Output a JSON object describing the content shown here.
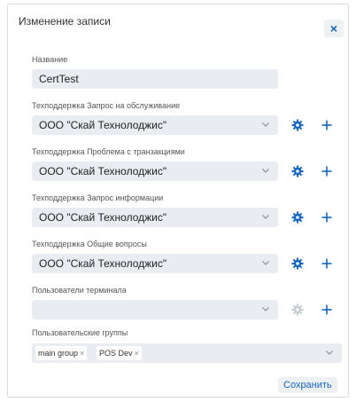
{
  "dialog": {
    "title": "Изменение записи",
    "close_label": "×",
    "save_label": "Сохранить"
  },
  "name_field": {
    "label": "Название",
    "value": "CertTest"
  },
  "selects": [
    {
      "label": "Техподдержка Запрос на обслуживание",
      "value": "ООО \"Скай Технолоджис\"",
      "gear_enabled": true
    },
    {
      "label": "Техподдержка Проблема с транзакциями",
      "value": "ООО \"Скай Технолоджис\"",
      "gear_enabled": true
    },
    {
      "label": "Техподдержка Запрос информации",
      "value": "ООО \"Скай Технолоджис\"",
      "gear_enabled": true
    },
    {
      "label": "Техподдержка Общие вопросы",
      "value": "ООО \"Скай Технолоджис\"",
      "gear_enabled": true
    },
    {
      "label": "Пользователи терминала",
      "value": "",
      "gear_enabled": false
    }
  ],
  "user_groups": {
    "label": "Пользовательские группы",
    "tags": [
      "main group",
      "POS Dev"
    ],
    "tag_remove_label": "×"
  },
  "colors": {
    "accent": "#1565c0",
    "field_bg": "#e9ecf0",
    "gear_disabled": "#c5cbd2"
  },
  "icons": {
    "settings": "gear-icon",
    "add": "plus-icon",
    "dropdown": "chevron-down-icon",
    "close": "close-icon"
  }
}
